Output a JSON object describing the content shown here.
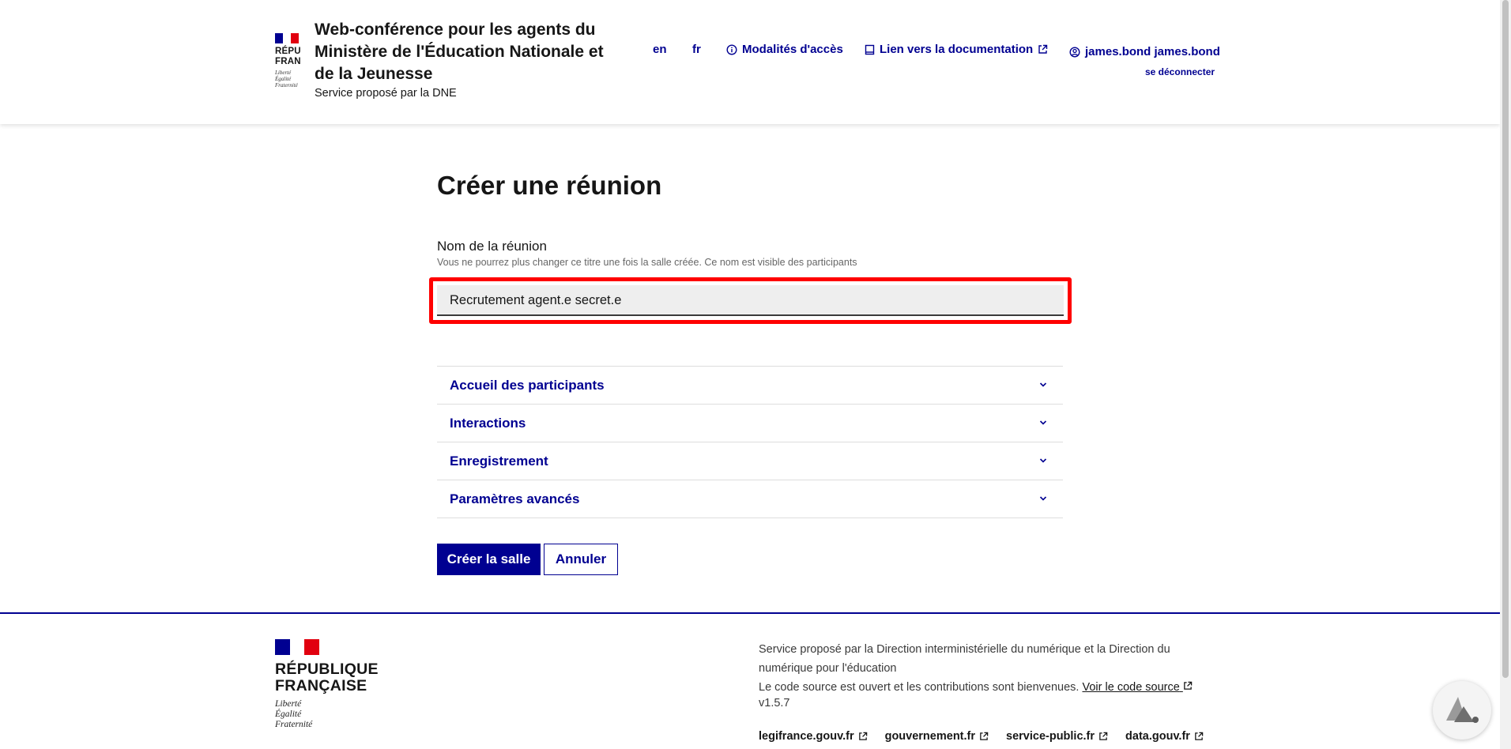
{
  "header": {
    "logo_lines": [
      "RÉPU",
      "FRAN"
    ],
    "logo_motto": [
      "Liberté",
      "Égalité",
      "Fraternité"
    ],
    "title": "Web-conférence pour les agents du Ministère de l'Éducation Nationale et de la Jeunesse",
    "tagline": "Service proposé par la DNE",
    "lang_en": "en",
    "lang_fr": "fr",
    "access_label": "Modalités d'accès",
    "docs_label": "Lien vers la documentation",
    "user_name": "james.bond james.bond",
    "logout_label": "se déconnecter"
  },
  "main": {
    "title": "Créer une réunion",
    "field_label": "Nom de la réunion",
    "field_hint": "Vous ne pourrez plus changer ce titre une fois la salle créée. Ce nom est visible des participants",
    "field_value": "Recrutement agent.e secret.e",
    "accordion": [
      "Accueil des participants",
      "Interactions",
      "Enregistrement",
      "Paramètres avancés"
    ],
    "create_button": "Créer la salle",
    "cancel_button": "Annuler"
  },
  "footer": {
    "logo_lines": [
      "RÉPUBLIQUE",
      "FRANÇAISE"
    ],
    "logo_motto": [
      "Liberté",
      "Égalité",
      "Fraternité"
    ],
    "text_line1": "Service proposé par la Direction interministérielle du numérique et la Direction du numérique pour l'éducation",
    "text_line2": "Le code source est ouvert et les contributions sont bienvenues.",
    "source_link": "Voir le code source",
    "version": "v1.5.7",
    "links": [
      "legifrance.gouv.fr",
      "gouvernement.fr",
      "service-public.fr",
      "data.gouv.fr"
    ]
  },
  "colors": {
    "brand_blue": "#000091",
    "marianne_red": "#e1000f",
    "highlight_red": "#ff0000"
  },
  "icons": {
    "access": "info-circle-icon",
    "docs": "book-icon",
    "external": "external-link-icon",
    "user": "user-circle-icon",
    "accordion": "chevron-down-icon"
  }
}
